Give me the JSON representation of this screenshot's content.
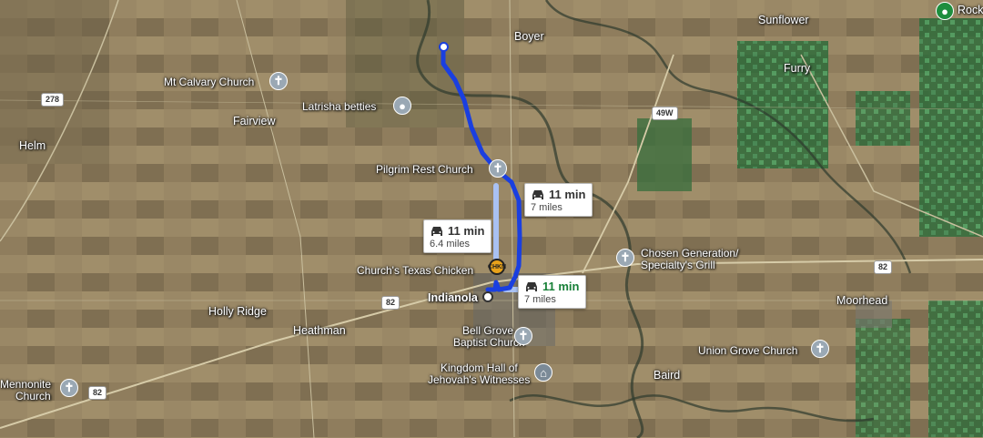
{
  "places": {
    "boyer": "Boyer",
    "sunflower": "Sunflower",
    "furry": "Furry",
    "rock": "Rock",
    "mt_calvary": "Mt Calvary Church",
    "latrisha": "Latrisha betties",
    "fairview": "Fairview",
    "helm": "Helm",
    "pilgrim": "Pilgrim Rest Church",
    "chosen_generation_1": "Chosen Generation/",
    "chosen_generation_2": "Specialty's Grill",
    "churchs_chicken": "Church's Texas Chicken",
    "indianola": "Indianola",
    "moorhead": "Moorhead",
    "holly_ridge": "Holly Ridge",
    "heathman": "Heathman",
    "bell_grove_1": "Bell Grove",
    "bell_grove_2": "Baptist Church",
    "kingdom_hall_1": "Kingdom Hall of",
    "kingdom_hall_2": "Jehovah's Witnesses",
    "union_grove": "Union Grove Church",
    "baird": "Baird",
    "mennonite_1": "Mennonite",
    "mennonite_2": "Church"
  },
  "roads": {
    "hwy_278": "278",
    "hwy_49w": "49W",
    "hwy_82_east": "82",
    "hwy_82_mid": "82",
    "hwy_82_west": "82"
  },
  "routes": [
    {
      "time": "11 min",
      "distance": "7 miles"
    },
    {
      "time": "11 min",
      "distance": "6.4 miles"
    },
    {
      "time": "11 min",
      "distance": "7 miles"
    }
  ],
  "colors": {
    "route_primary": "#1a3fe0",
    "route_alt": "#a9c1f2",
    "selected_time": "#188038",
    "pin_church": "#9aa8b4",
    "pin_place": "#1e8e3e"
  },
  "icons": {
    "church_pin": "church-icon",
    "place_pin": "map-pin-icon",
    "kingdom_pin": "kingdom-hall-icon",
    "car": "car-icon",
    "restaurant": "chicken-logo-icon"
  }
}
